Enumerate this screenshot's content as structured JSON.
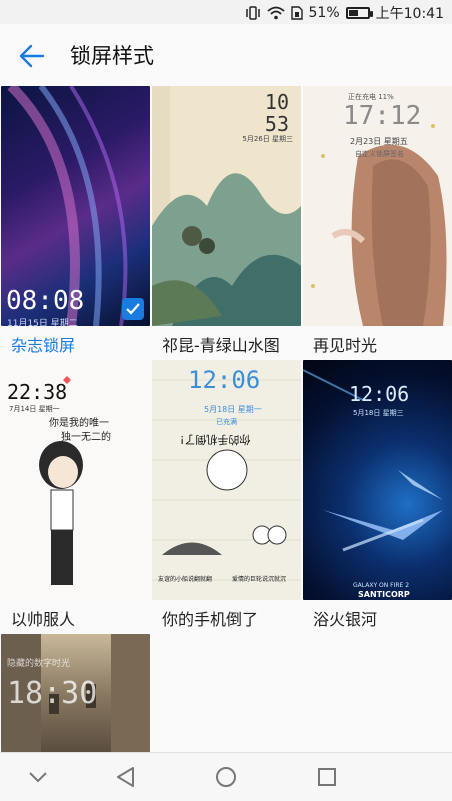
{
  "status": {
    "battery_percent": "51%",
    "time": "上午10:41",
    "battery_level": 0.51
  },
  "header": {
    "title": "锁屏样式"
  },
  "themes": [
    {
      "name": "杂志锁屏",
      "selected": true,
      "time": "08:08",
      "date": "11月15日 星期二"
    },
    {
      "name": "祁昆-青绿山水图",
      "selected": false,
      "time_hour": "10",
      "time_min": "53",
      "date": "5月26日 星期三"
    },
    {
      "name": "再见时光",
      "selected": false,
      "charging": "正在充电 11%",
      "time": "17:12",
      "date": "2月23日 星期五",
      "extra": "自定义锁屏签名"
    },
    {
      "name": "以帅服人",
      "selected": false,
      "time": "22:38",
      "date": "7月14日 星期一",
      "text1": "你是我的唯一",
      "text2": "独一无二的"
    },
    {
      "name": "你的手机倒了",
      "selected": false,
      "time": "12:06",
      "date": "5月18日 星期一",
      "extra": "已充满",
      "upside": "你的手机倒了!",
      "cap1": "友谊的小船说翻就翻",
      "cap2": "爱情的巨轮说沉就沉"
    },
    {
      "name": "浴火银河",
      "selected": false,
      "time": "12:06",
      "date": "5月18日 星期三",
      "brand1": "GALAXY ON FIRE 2",
      "brand2": "SANTICORP"
    },
    {
      "name": "",
      "selected": false,
      "title": "隐藏的数字时光",
      "time": "18:30"
    }
  ],
  "icons": {
    "back": "arrow-left-icon",
    "check": "check-icon",
    "nav_down": "chevron-down-icon",
    "nav_back": "triangle-back-icon",
    "nav_home": "circle-home-icon",
    "nav_recent": "square-recent-icon"
  }
}
